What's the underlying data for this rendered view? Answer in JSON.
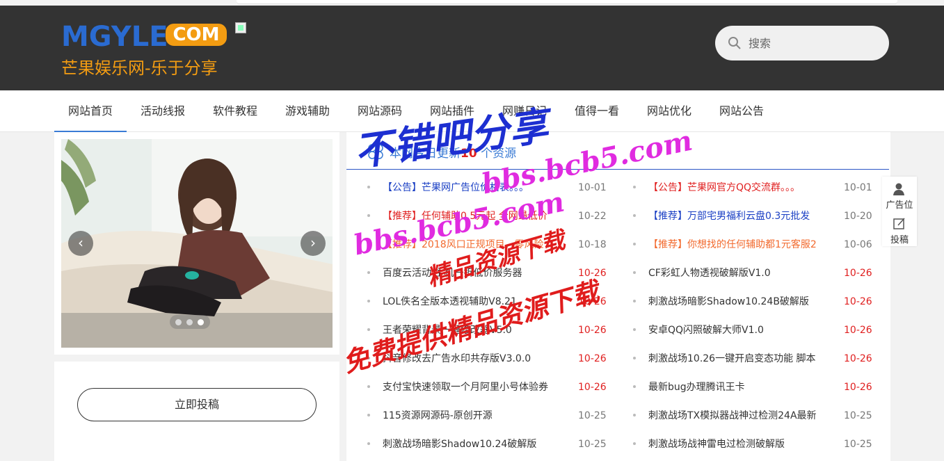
{
  "header": {
    "logo_main": "MGYLE",
    "logo_badge": "COM",
    "slogan": "芒果娱乐网-乐于分享",
    "search_placeholder": "搜索"
  },
  "nav": [
    {
      "label": "网站首页",
      "active": true
    },
    {
      "label": "活动线报"
    },
    {
      "label": "软件教程"
    },
    {
      "label": "游戏辅助"
    },
    {
      "label": "网站源码"
    },
    {
      "label": "网站插件"
    },
    {
      "label": "网赚日记"
    },
    {
      "label": "值得一看"
    },
    {
      "label": "网站优化"
    },
    {
      "label": "网站公告"
    }
  ],
  "submit_button": "立即投稿",
  "news": {
    "heading_prefix": "本网今日更新",
    "heading_count": "10",
    "heading_suffix": "个资源",
    "left": [
      {
        "title": "【公告】芒果网广告位价格表。。。",
        "date": "10-01",
        "color": "#1a3fc4"
      },
      {
        "title": "【推荐】任何辅助0.5元起 全网最低价",
        "date": "10-22",
        "color": "#e02020"
      },
      {
        "title": "【推荐】2018风口正规项目，零风险",
        "date": "10-18",
        "color": "#f26a2e"
      },
      {
        "title": "百度云活动 主机一折低价服务器",
        "date": "10-26",
        "color": "#333333",
        "hot": true
      },
      {
        "title": "LOL佚名全版本透视辅助V8.21",
        "date": "10-26",
        "color": "#333333",
        "hot": true
      },
      {
        "title": "王者荣耀背景一键修改器V5.0",
        "date": "10-26",
        "color": "#333333",
        "hot": true
      },
      {
        "title": "抖音修改去广告水印共存版V3.0.0",
        "date": "10-26",
        "color": "#333333",
        "hot": true
      },
      {
        "title": "支付宝快速领取一个月阿里小号体验券",
        "date": "10-26",
        "color": "#333333",
        "hot": true
      },
      {
        "title": "115资源网源码-原创开源",
        "date": "10-25",
        "color": "#333333"
      },
      {
        "title": "刺激战场暗影Shadow10.24破解版",
        "date": "10-25",
        "color": "#333333"
      }
    ],
    "right": [
      {
        "title": "【公告】芒果网官方QQ交流群。。。",
        "date": "10-01",
        "color": "#e02020"
      },
      {
        "title": "【推荐】万部宅男福利云盘0.3元批发",
        "date": "10-20",
        "color": "#1a3fc4"
      },
      {
        "title": "【推荐】你想找的任何辅助都1元客服2",
        "date": "10-06",
        "color": "#f26a2e"
      },
      {
        "title": "CF彩虹人物透视破解版V1.0",
        "date": "10-26",
        "color": "#333333",
        "hot": true
      },
      {
        "title": "刺激战场暗影Shadow10.24B破解版",
        "date": "10-26",
        "color": "#333333",
        "hot": true
      },
      {
        "title": "安卓QQ闪照破解大师V1.0",
        "date": "10-26",
        "color": "#333333",
        "hot": true
      },
      {
        "title": "刺激战场10.26一键开启变态功能 脚本",
        "date": "10-26",
        "color": "#333333",
        "hot": true
      },
      {
        "title": "最新bug办理腾讯王卡",
        "date": "10-26",
        "color": "#333333",
        "hot": true
      },
      {
        "title": "刺激战场TX模拟器战神过检测24A最新",
        "date": "10-25",
        "color": "#333333"
      },
      {
        "title": "刺激战场战神雷电过检测破解版",
        "date": "10-25",
        "color": "#333333"
      }
    ]
  },
  "side_tools": {
    "ad": "广告位",
    "submit": "投稿"
  },
  "watermark": {
    "line1": "不错吧分享",
    "line2": "bbs.bcb5.com",
    "line3": "bbs.bcb5.com",
    "line4": "精品资源下载",
    "line5": "免费提供精品资源下载"
  },
  "colors": {
    "accent": "#3a7bd5",
    "header_bg": "#333333",
    "hot_date": "#e02020"
  }
}
